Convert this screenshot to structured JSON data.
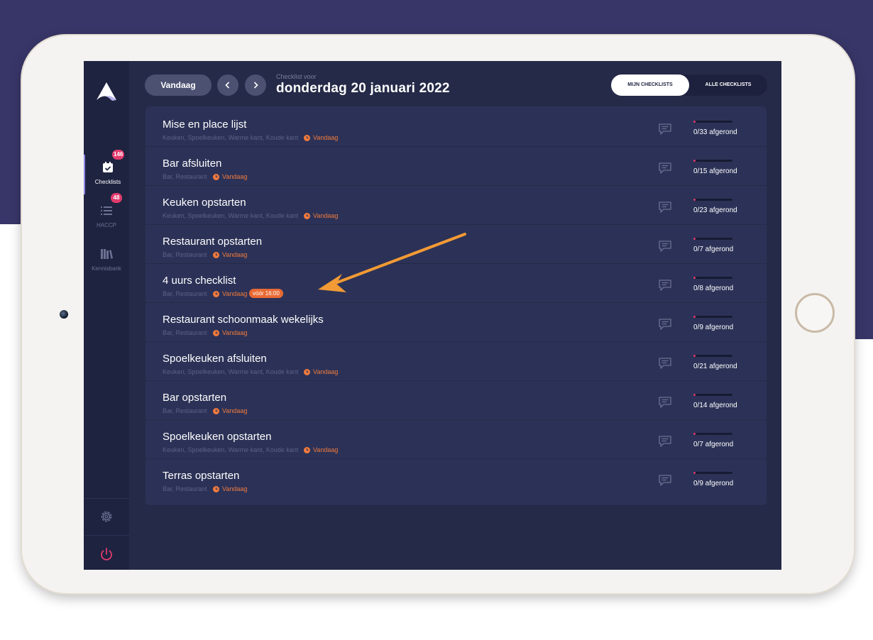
{
  "header": {
    "today_button": "Vandaag",
    "subtitle": "Checklist voor",
    "date": "donderdag 20 januari 2022",
    "toggle_mine": "MIJN CHECKLISTS",
    "toggle_all": "ALLE CHECKLISTS"
  },
  "sidebar": {
    "items": [
      {
        "label": "Checklists",
        "badge": "146",
        "icon": "calendar-check-icon",
        "active": true
      },
      {
        "label": "HACCP",
        "badge": "48",
        "icon": "list-icon",
        "active": false
      },
      {
        "label": "Kennisbank",
        "badge": "",
        "icon": "books-icon",
        "active": false
      }
    ],
    "settings_icon": "gear-icon",
    "logout_icon": "power-icon"
  },
  "colors": {
    "accent": "#f07a3d",
    "badge": "#e23b6e",
    "background": "#252a48",
    "sidebar": "#1e2340",
    "brand_top": "#383668"
  },
  "checklists": [
    {
      "title": "Mise en place lijst",
      "tags": "Keuken, Spoelkeuken, Warme kant, Koude kant",
      "time": "Vandaag",
      "deadline": "",
      "progress": "0/33 afgerond"
    },
    {
      "title": "Bar afsluiten",
      "tags": "Bar, Restaurant",
      "time": "Vandaag",
      "deadline": "",
      "progress": "0/15 afgerond"
    },
    {
      "title": "Keuken opstarten",
      "tags": "Keuken, Spoelkeuken, Warme kant, Koude kant",
      "time": "Vandaag",
      "deadline": "",
      "progress": "0/23 afgerond"
    },
    {
      "title": "Restaurant opstarten",
      "tags": "Bar, Restaurant",
      "time": "Vandaag",
      "deadline": "",
      "progress": "0/7 afgerond"
    },
    {
      "title": "4 uurs checklist",
      "tags": "Bar, Restaurant",
      "time": "Vandaag",
      "deadline": "vóór 16:00",
      "progress": "0/8 afgerond"
    },
    {
      "title": "Restaurant schoonmaak wekelijks",
      "tags": "Bar, Restaurant",
      "time": "Vandaag",
      "deadline": "",
      "progress": "0/9 afgerond"
    },
    {
      "title": "Spoelkeuken afsluiten",
      "tags": "Keuken, Spoelkeuken, Warme kant, Koude kant",
      "time": "Vandaag",
      "deadline": "",
      "progress": "0/21 afgerond"
    },
    {
      "title": "Bar opstarten",
      "tags": "Bar, Restaurant",
      "time": "Vandaag",
      "deadline": "",
      "progress": "0/14 afgerond"
    },
    {
      "title": "Spoelkeuken opstarten",
      "tags": "Keuken, Spoelkeuken, Warme kant, Koude kant",
      "time": "Vandaag",
      "deadline": "",
      "progress": "0/7 afgerond"
    },
    {
      "title": "Terras opstarten",
      "tags": "Bar, Restaurant",
      "time": "Vandaag",
      "deadline": "",
      "progress": "0/9 afgerond"
    }
  ]
}
